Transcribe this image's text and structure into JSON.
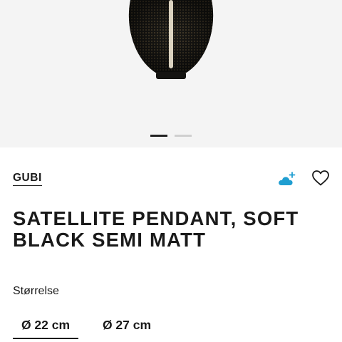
{
  "brand": {
    "name": "GUBI"
  },
  "product": {
    "title": "SATELLITE PENDANT, SOFT BLACK SEMI MATT"
  },
  "gallery": {
    "slides": 2,
    "active_index": 0
  },
  "actions": {
    "cloud_icon": "cloud-plus-icon",
    "heart_icon": "heart-icon",
    "accent_color": "#1f9ed1"
  },
  "size_selector": {
    "label": "Størrelse",
    "options": [
      {
        "label": "Ø 22 cm",
        "selected": true
      },
      {
        "label": "Ø 27 cm",
        "selected": false
      }
    ]
  }
}
